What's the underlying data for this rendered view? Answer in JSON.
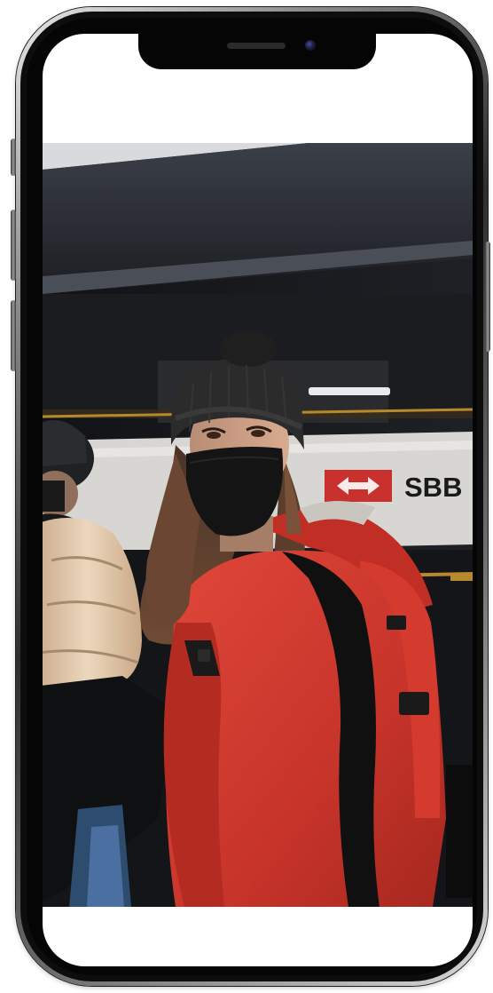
{
  "screen": {
    "photo": {
      "subject": "person-in-red-jacket-beanie-mask",
      "sign_text": "SBB"
    }
  },
  "colors": {
    "frame": "#2e2e2e",
    "bezel": "#050505",
    "screen_bg": "#ffffff",
    "jacket": "#d8392e",
    "beanie": "#2b2b2b",
    "sign_red": "#c8312e"
  }
}
